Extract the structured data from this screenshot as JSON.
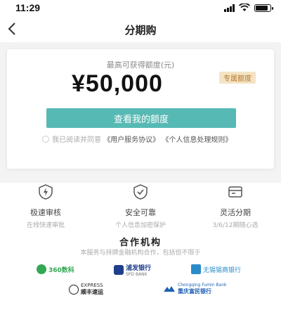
{
  "status_bar": {
    "time": "11:29"
  },
  "nav": {
    "title": "分期购"
  },
  "credit_card": {
    "limit_label": "最高可获得额度(元)",
    "amount": "¥50,000",
    "badge": "专属额度",
    "view_button": "查看我的额度",
    "agreement_prefix": "我已阅读并同意",
    "agreement_link_1": "《用户服务协议》",
    "agreement_link_2": "《个人信息处理规则》"
  },
  "features": [
    {
      "icon": "shield-lightning-icon",
      "title": "极速审核",
      "subtitle": "在线快速审批"
    },
    {
      "icon": "shield-check-icon",
      "title": "安全可靠",
      "subtitle": "个人信息加密保护"
    },
    {
      "icon": "calendar-card-icon",
      "title": "灵活分期",
      "subtitle": "3/6/12期随心选"
    }
  ],
  "partners": {
    "title": "合作机构",
    "subtitle": "本服务与持牌金融机构合作，包括但不限于",
    "logos": [
      {
        "name": "360数科",
        "color": "#33a852"
      },
      {
        "name": "浦发银行",
        "sub": "SPD BANK",
        "color": "#1f3e8c"
      },
      {
        "name": "无锡锡商银行",
        "color": "#2a8bc9"
      },
      {
        "name": "顺丰速运",
        "sub": "EXPRESS",
        "color": "#222222"
      },
      {
        "name": "重庆富民银行",
        "sub": "Chongqing Fumin Bank",
        "color": "#1d5fb3"
      }
    ]
  },
  "colors": {
    "accent": "#57b9b4",
    "badge_bg": "#f4e3c4",
    "badge_text": "#b57a2c"
  }
}
